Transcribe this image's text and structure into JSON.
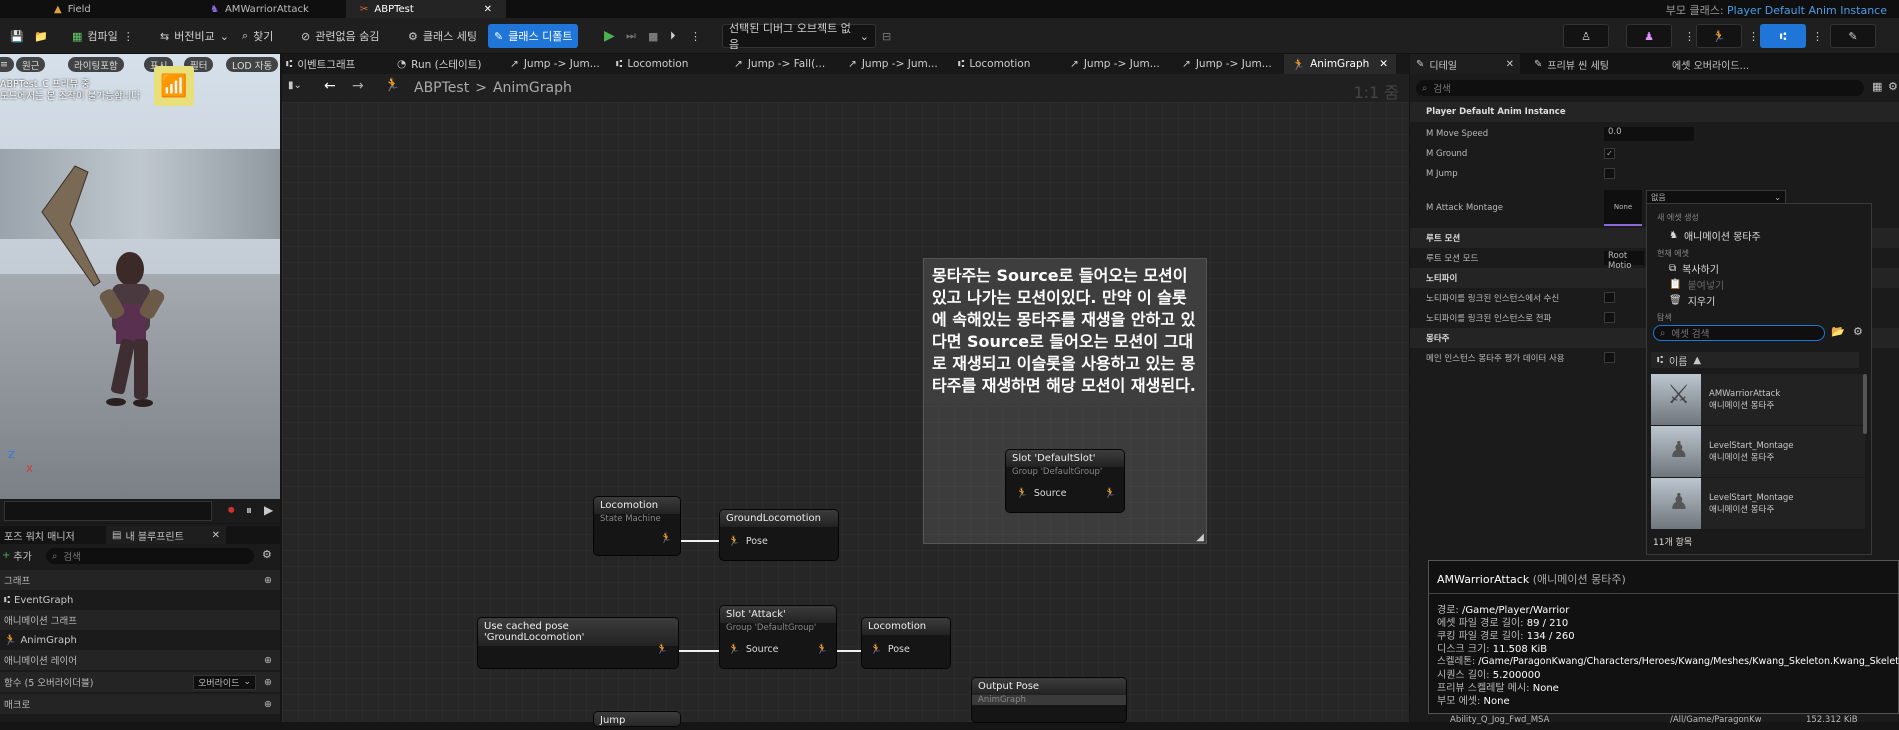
{
  "tabs": [
    {
      "label": "Field"
    },
    {
      "label": "AMWarriorAttack"
    },
    {
      "label": "ABPTest"
    }
  ],
  "parent_class": {
    "label": "부모 클래스:",
    "value": "Player Default Anim Instance"
  },
  "toolbar": {
    "compile": "컴파일",
    "diff": "버전비교",
    "find": "찾기",
    "hide_unrelated": "관련없음 숨김",
    "class_settings": "클래스 세팅",
    "class_defaults": "클래스 디폴트",
    "debug_object": "선택된 디버그 오브젝트 없음"
  },
  "viewport": {
    "buttons": [
      "원근",
      "라이팅포함",
      "표시",
      "필터",
      "LOD 자동"
    ],
    "overlay_line1": "ABPTest_C 프리뷰 중",
    "overlay_line2": "모드에서는 본 조작이 불가능합니다",
    "axis_z": "Z",
    "axis_x": "X"
  },
  "left_panel": {
    "tab1": "포즈 워치 매니저",
    "tab2": "내 블루프린트",
    "add": "추가",
    "search_placeholder": "검색",
    "sections": [
      {
        "label": "그래프"
      },
      {
        "label": "EventGraph"
      },
      {
        "label": "애니메이션 그래프"
      },
      {
        "label": "AnimGraph"
      },
      {
        "label": "애니메이션 레이어"
      },
      {
        "label": "함수 (5 오버라이더블)"
      },
      {
        "label": "매크로"
      }
    ],
    "override": "오버라이드"
  },
  "graph_tabs": [
    {
      "label": "이벤트그래프"
    },
    {
      "label": "Run (스테이트)"
    },
    {
      "label": "Jump -> Jum..."
    },
    {
      "label": "Locomotion"
    },
    {
      "label": "Jump -> Fall(..."
    },
    {
      "label": "Jump -> Jum..."
    },
    {
      "label": "Locomotion"
    },
    {
      "label": "Jump -> Jum..."
    },
    {
      "label": "Jump -> Jum..."
    },
    {
      "label": "AnimGraph"
    }
  ],
  "breadcrumb": {
    "root": "ABPTest",
    "leaf": "AnimGraph",
    "zoom": "1:1 줌"
  },
  "comment": {
    "text": "몽타주는 Source로 들어오는 모션이 있고 나가는 모션이있다. 만약 이 슬롯에 속해있는 몽타주를 재생을 안하고 있다면 Source로 들어오는 모션이 그대로 재생되고 이슬롯을 사용하고 있는 몽타주를 재생하면 해당 모션이 재생된다."
  },
  "nodes": {
    "slot_default": {
      "title": "Slot 'DefaultSlot'",
      "sub": "Group 'DefaultGroup'",
      "pin": "Source"
    },
    "locomotion_sm": {
      "title": "Locomotion",
      "sub": "State Machine"
    },
    "ground_locomotion": {
      "title": "GroundLocomotion",
      "pin": "Pose"
    },
    "use_cached": {
      "title": "Use cached pose 'GroundLocomotion'"
    },
    "slot_attack": {
      "title": "Slot 'Attack'",
      "sub": "Group 'DefaultGroup'",
      "pin": "Source"
    },
    "locomotion2": {
      "title": "Locomotion",
      "pin": "Pose"
    },
    "output_pose": {
      "title": "Output Pose",
      "sub": "AnimGraph"
    },
    "jump": {
      "title": "Jump"
    }
  },
  "details": {
    "tab1": "디테일",
    "tab2": "프리뷰 씬 세팅",
    "tab3": "에셋 오버라이드...",
    "search_placeholder": "검색",
    "section_main": "Player Default Anim Instance",
    "move_speed_label": "M Move Speed",
    "move_speed_value": "0.0",
    "ground_label": "M Ground",
    "jump_label": "M Jump",
    "montage_label": "M Attack Montage",
    "montage_thumb": "None",
    "montage_value": "없음",
    "root_motion_section": "루트 모션",
    "root_motion_label": "루트 모션 모드",
    "root_motion_value": "Root Motio",
    "notify_section": "노티파이",
    "notify1": "노티파이를 링크된 인스턴스에서 수신",
    "notify2": "노티파이를 링크된 인스턴스로 전파",
    "montage_section": "몽타주",
    "montage_eval": "메인 인스턴스 몽타주 평가 데이터 사용",
    "bottom_row": {
      "name": "Ability_Q_Jog_Fwd_MSA",
      "path": "/All/Game/ParagonKw",
      "size": "152.312 KiB"
    }
  },
  "popup": {
    "new_asset_hdr": "새 에셋 생성",
    "new_montage": "애니메이션 몽타주",
    "current_asset_hdr": "현재 에셋",
    "copy": "복사하기",
    "paste": "붙여넣기",
    "clear": "지우기",
    "browse_hdr": "탐색",
    "search_placeholder": "에셋 검색",
    "sort": "이름",
    "assets": [
      {
        "name": "AMWarriorAttack",
        "type": "애니메이션 몽타주"
      },
      {
        "name": "LevelStart_Montage",
        "type": "애니메이션 몽타주"
      },
      {
        "name": "LevelStart_Montage",
        "type": "애니메이션 몽타주"
      }
    ],
    "count": "11개 항목"
  },
  "tooltip": {
    "title": "AMWarriorAttack",
    "title_type": "(애니메이션 몽타주)",
    "rows": [
      {
        "k": "경로:",
        "v": "/Game/Player/Warrior"
      },
      {
        "k": "에셋 파일 경로 길이:",
        "v": "89 / 210"
      },
      {
        "k": "쿠킹 파일 경로 길이:",
        "v": "134 / 260"
      },
      {
        "k": "디스크 크기:",
        "v": "11.508 KiB"
      },
      {
        "k": "스켈레톤:",
        "v": "/Game/ParagonKwang/Characters/Heroes/Kwang/Meshes/Kwang_Skeleton.Kwang_Skeleton"
      },
      {
        "k": "시퀀스 길이:",
        "v": "5.200000"
      },
      {
        "k": "프리뷰 스켈레탈 메시:",
        "v": "None"
      },
      {
        "k": "부모 에셋:",
        "v": "None"
      }
    ]
  },
  "colors": {
    "accent": "#1f76d8",
    "exec": "#f0f0f0",
    "play": "#4caf50",
    "record": "#d03030"
  }
}
